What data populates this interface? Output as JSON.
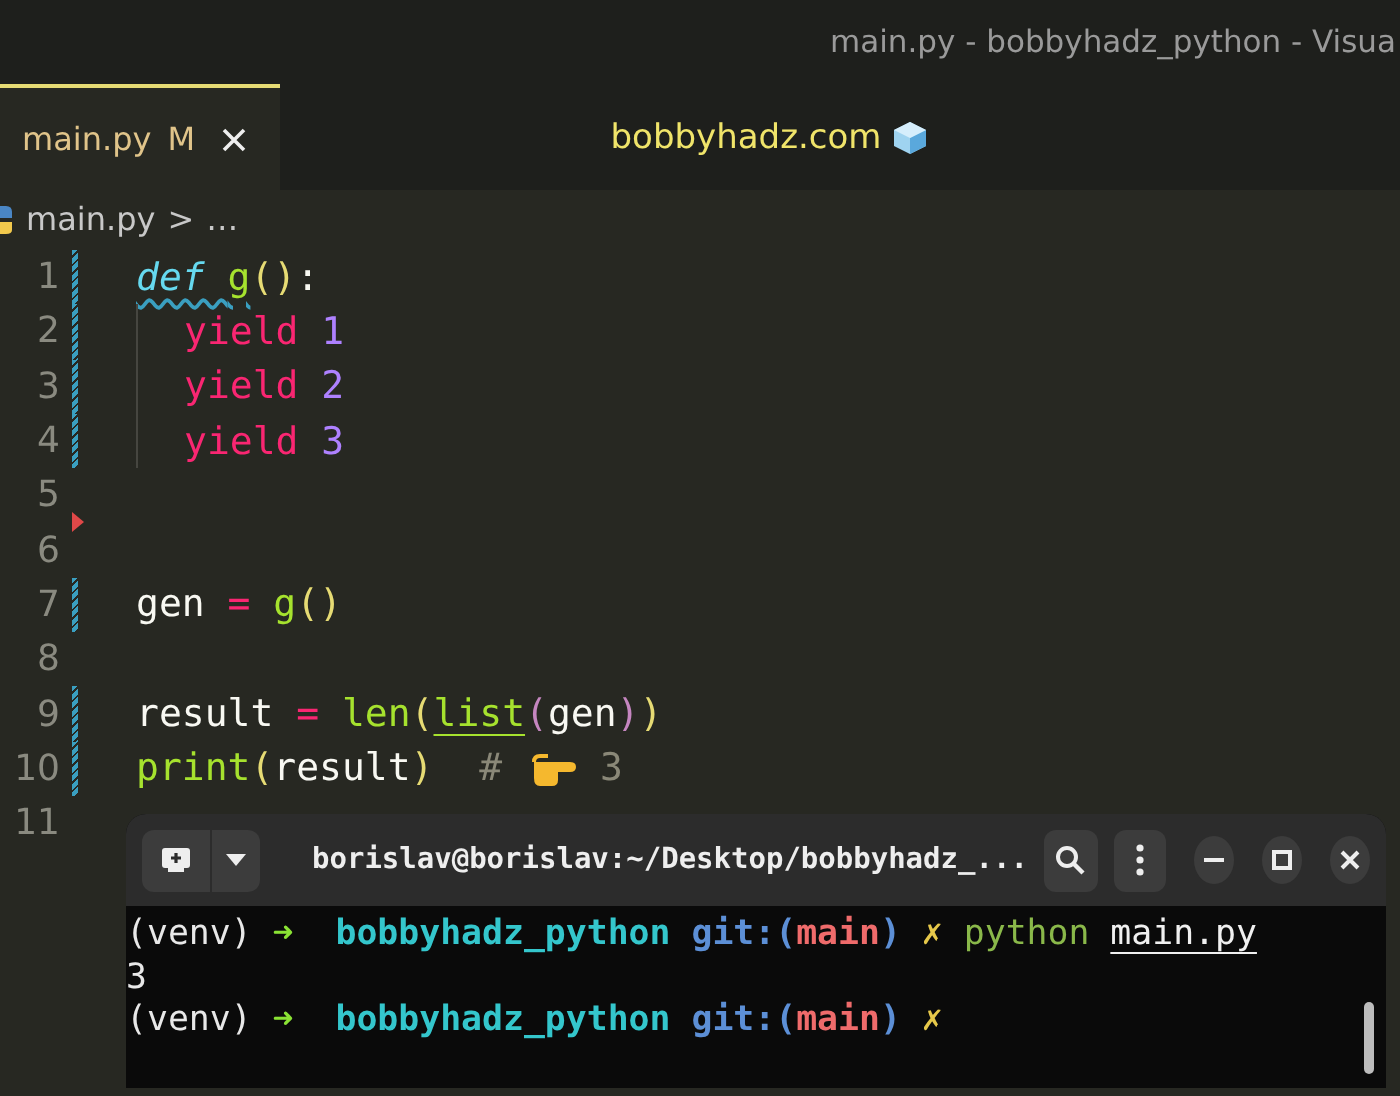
{
  "window": {
    "title": "main.py - bobbyhadz_python - Visua"
  },
  "tabs": [
    {
      "label": "main.py",
      "badge": "M",
      "selected": true
    }
  ],
  "banner": {
    "text": "bobbyhadz.com"
  },
  "breadcrumb": {
    "file": "main.py",
    "separator": ">",
    "rest": "…"
  },
  "code": [
    {
      "number": "1",
      "modified": true,
      "deleted_below": false,
      "tokens": [
        {
          "kind": "keyword",
          "text": "def ",
          "squiggle": true
        },
        {
          "kind": "func",
          "text": "g",
          "squiggle": true
        },
        {
          "kind": "paren",
          "text": "()"
        },
        {
          "kind": "punct",
          "text": ":"
        }
      ],
      "children": [
        {
          "number": "2",
          "modified": true,
          "deleted_below": false,
          "tokens": [
            {
              "kind": "yield",
              "text": "yield "
            },
            {
              "kind": "number",
              "text": "1"
            }
          ]
        },
        {
          "number": "3",
          "modified": true,
          "deleted_below": false,
          "tokens": [
            {
              "kind": "yield",
              "text": "yield "
            },
            {
              "kind": "number",
              "text": "2"
            }
          ]
        },
        {
          "number": "4",
          "modified": true,
          "deleted_below": false,
          "tokens": [
            {
              "kind": "yield",
              "text": "yield "
            },
            {
              "kind": "number",
              "text": "3"
            }
          ]
        }
      ]
    },
    {
      "number": "5",
      "modified": false,
      "deleted_below": true
    },
    {
      "number": "6",
      "modified": false,
      "deleted_below": false
    },
    {
      "number": "7",
      "modified": true,
      "deleted_below": false,
      "tokens": [
        {
          "kind": "ident",
          "text": "gen "
        },
        {
          "kind": "op",
          "text": "= "
        },
        {
          "kind": "func",
          "text": "g"
        },
        {
          "kind": "paren",
          "text": "()"
        }
      ]
    },
    {
      "number": "8",
      "modified": false,
      "deleted_below": false
    },
    {
      "number": "9",
      "modified": true,
      "deleted_below": false,
      "tokens": [
        {
          "kind": "ident",
          "text": "result "
        },
        {
          "kind": "op",
          "text": "= "
        },
        {
          "kind": "func",
          "text": "len"
        },
        {
          "kind": "paren",
          "text": "("
        },
        {
          "kind": "func",
          "text": "list",
          "underline": true
        },
        {
          "kind": "paren2",
          "text": "("
        },
        {
          "kind": "ident",
          "text": "gen"
        },
        {
          "kind": "paren2",
          "text": ")"
        },
        {
          "kind": "paren",
          "text": ")"
        }
      ]
    },
    {
      "number": "10",
      "modified": true,
      "deleted_below": false,
      "tokens": [
        {
          "kind": "func",
          "text": "print"
        },
        {
          "kind": "paren",
          "text": "("
        },
        {
          "kind": "ident",
          "text": "result"
        },
        {
          "kind": "paren",
          "text": ")"
        },
        {
          "kind": "comment",
          "text": "  # "
        },
        {
          "kind": "hand"
        },
        {
          "kind": "comment",
          "text": " 3"
        }
      ]
    },
    {
      "number": "11",
      "modified": false,
      "deleted_below": false
    }
  ],
  "terminal": {
    "title": "borislav@borislav:~/Desktop/bobbyhadz_...",
    "lines": [
      [
        {
          "kind": "plain",
          "text": "(venv) "
        },
        {
          "kind": "arrow",
          "text": "➜  "
        },
        {
          "kind": "dir",
          "text": "bobbyhadz_python "
        },
        {
          "kind": "git",
          "text": "git:("
        },
        {
          "kind": "branch",
          "text": "main"
        },
        {
          "kind": "git",
          "text": ") "
        },
        {
          "kind": "x",
          "text": "✗ "
        },
        {
          "kind": "cmd",
          "text": "python "
        },
        {
          "kind": "arg",
          "text": "main.py"
        }
      ],
      [
        {
          "kind": "plain",
          "text": "3"
        }
      ],
      [
        {
          "kind": "plain",
          "text": "(venv) "
        },
        {
          "kind": "arrow",
          "text": "➜  "
        },
        {
          "kind": "dir",
          "text": "bobbyhadz_python "
        },
        {
          "kind": "git",
          "text": "git:("
        },
        {
          "kind": "branch",
          "text": "main"
        },
        {
          "kind": "git",
          "text": ") "
        },
        {
          "kind": "x",
          "text": "✗"
        }
      ]
    ]
  }
}
